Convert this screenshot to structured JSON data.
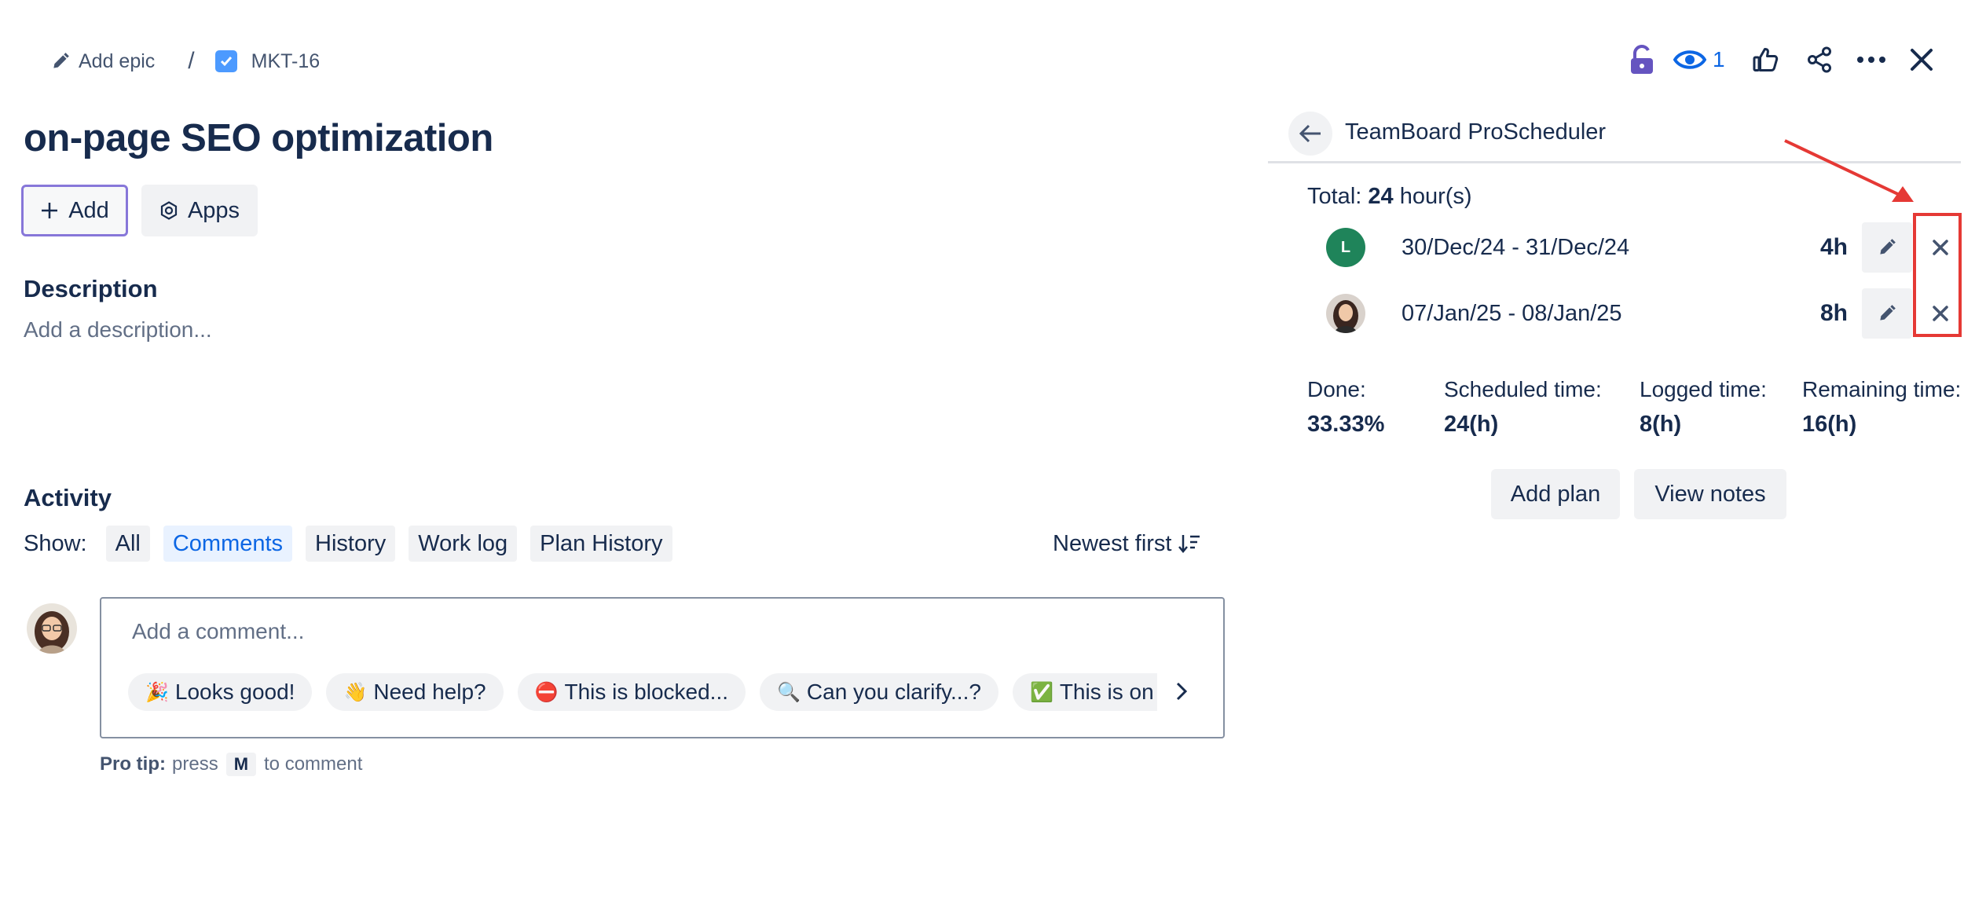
{
  "breadcrumb": {
    "epic_label": "Add epic",
    "separator": "/",
    "issue_key": "MKT-16"
  },
  "header": {
    "watch_count": "1"
  },
  "issue": {
    "title": "on-page SEO optimization",
    "add_label": "Add",
    "apps_label": "Apps",
    "description_heading": "Description",
    "description_placeholder": "Add a description..."
  },
  "activity": {
    "heading": "Activity",
    "show_label": "Show:",
    "filters": [
      "All",
      "Comments",
      "History",
      "Work log",
      "Plan History"
    ],
    "active_filter": "Comments",
    "sort_label": "Newest first",
    "comment_placeholder": "Add a comment...",
    "quick_replies": [
      {
        "emoji": "🎉",
        "text": "Looks good!"
      },
      {
        "emoji": "👋",
        "text": "Need help?"
      },
      {
        "emoji": "⛔",
        "text": "This is blocked..."
      },
      {
        "emoji": "🔍",
        "text": "Can you clarify...?"
      },
      {
        "emoji": "✅",
        "text": "This is on track"
      }
    ],
    "pro_tip": {
      "label": "Pro tip:",
      "press": "press",
      "key": "M",
      "suffix": "to comment"
    }
  },
  "scheduler": {
    "title": "TeamBoard ProScheduler",
    "total_label": "Total:",
    "total_value": "24",
    "total_unit": "hour(s)",
    "plans": [
      {
        "avatar_initial": "L",
        "dates": "30/Dec/24 - 31/Dec/24",
        "hours": "4h"
      },
      {
        "avatar_initial": "",
        "dates": "07/Jan/25 - 08/Jan/25",
        "hours": "8h"
      }
    ],
    "stats": [
      {
        "label": "Done:",
        "value": "33.33%"
      },
      {
        "label": "Scheduled time:",
        "value": "24(h)"
      },
      {
        "label": "Logged time:",
        "value": "8(h)"
      },
      {
        "label": "Remaining time:",
        "value": "16(h)"
      }
    ],
    "add_plan_label": "Add plan",
    "view_notes_label": "View notes"
  },
  "colors": {
    "accent": "#0c66e4",
    "lock": "#6554c0",
    "highlight": "#e53935",
    "avatar_green": "#1f845a"
  }
}
